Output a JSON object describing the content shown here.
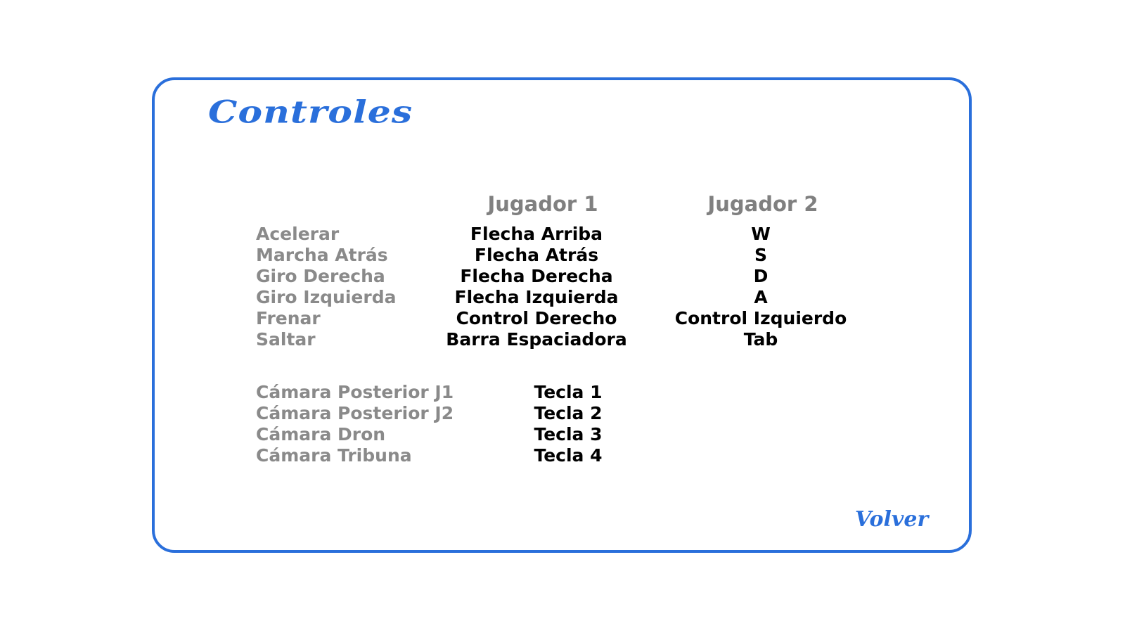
{
  "title": "Controles",
  "headers": {
    "player1": "Jugador 1",
    "player2": "Jugador 2"
  },
  "driving_controls": [
    {
      "action": "Acelerar",
      "player1": "Flecha Arriba",
      "player2": "W"
    },
    {
      "action": "Marcha Atrás",
      "player1": "Flecha Atrás",
      "player2": "S"
    },
    {
      "action": "Giro Derecha",
      "player1": "Flecha Derecha",
      "player2": "D"
    },
    {
      "action": "Giro Izquierda",
      "player1": "Flecha Izquierda",
      "player2": "A"
    },
    {
      "action": "Frenar",
      "player1": "Control Derecho",
      "player2": "Control Izquierdo"
    },
    {
      "action": "Saltar",
      "player1": "Barra Espaciadora",
      "player2": "Tab"
    }
  ],
  "camera_controls": [
    {
      "action": "Cámara Posterior J1",
      "key": "Tecla 1"
    },
    {
      "action": "Cámara Posterior J2",
      "key": "Tecla 2"
    },
    {
      "action": "Cámara Dron",
      "key": "Tecla 3"
    },
    {
      "action": "Cámara Tribuna",
      "key": "Tecla 4"
    }
  ],
  "back_label": "Volver",
  "colors": {
    "accent": "#2a6fdb",
    "action_text": "#8a8a8a",
    "key_text": "#000000"
  }
}
